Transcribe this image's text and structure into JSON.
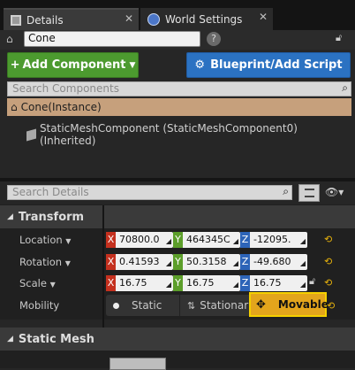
{
  "tabs": [
    {
      "label": "Details",
      "icon": "details-icon"
    },
    {
      "label": "World Settings",
      "icon": "globe-icon"
    }
  ],
  "actor": {
    "name": "Cone"
  },
  "toolbar": {
    "add_component": "Add Component",
    "blueprint": "Blueprint/Add Script"
  },
  "components": {
    "search_placeholder": "Search Components",
    "root": "Cone(Instance)",
    "child": "StaticMeshComponent (StaticMeshComponent0) (Inherited)"
  },
  "details": {
    "search_placeholder": "Search Details"
  },
  "transform": {
    "title": "Transform",
    "location": {
      "label": "Location",
      "x": "70800.0",
      "y": "464345C",
      "z": "-12095."
    },
    "rotation": {
      "label": "Rotation",
      "x": "0.41593",
      "y": "50.3158",
      "z": "-49.680"
    },
    "scale": {
      "label": "Scale",
      "x": "16.75",
      "y": "16.75",
      "z": "16.75"
    },
    "mobility": {
      "label": "Mobility",
      "static": "Static",
      "stationary": "Stationar",
      "movable": "Movable",
      "selected": "Movable"
    }
  },
  "static_mesh": {
    "title": "Static Mesh"
  },
  "colors": {
    "add_button": "#4c9a2f",
    "blueprint_button": "#2b72c2",
    "selected_mobility": "#e3a51c",
    "axis_x": "#c4301e",
    "axis_y": "#5c9e2a",
    "axis_z": "#2d64b8"
  }
}
